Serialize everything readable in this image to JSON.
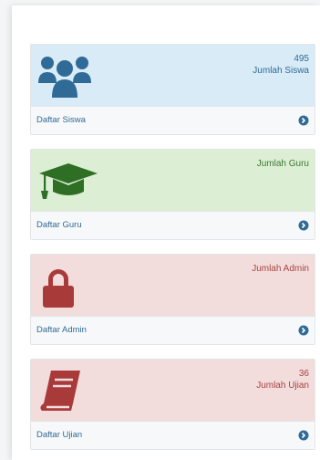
{
  "panels": [
    {
      "id": "siswa",
      "count": "495",
      "stat_label": "Jumlah Siswa",
      "footer_label": "Daftar Siswa",
      "icon": "users-icon",
      "theme": "blue",
      "icon_color": "#2f6b96"
    },
    {
      "id": "guru",
      "count": "",
      "stat_label": "Jumlah Guru",
      "footer_label": "Daftar Guru",
      "icon": "graduation-cap-icon",
      "theme": "green",
      "icon_color": "#2f6e25"
    },
    {
      "id": "admin",
      "count": "",
      "stat_label": "Jumlah Admin",
      "footer_label": "Daftar Admin",
      "icon": "lock-icon",
      "theme": "red",
      "icon_color": "#a83a3a"
    },
    {
      "id": "ujian",
      "count": "36",
      "stat_label": "Jumlah Ujian",
      "footer_label": "Daftar Ujian",
      "icon": "book-icon",
      "theme": "red",
      "icon_color": "#a83a3a"
    }
  ],
  "colors": {
    "footer_text": "#2f6b96",
    "arrow": "#2f6b96"
  }
}
